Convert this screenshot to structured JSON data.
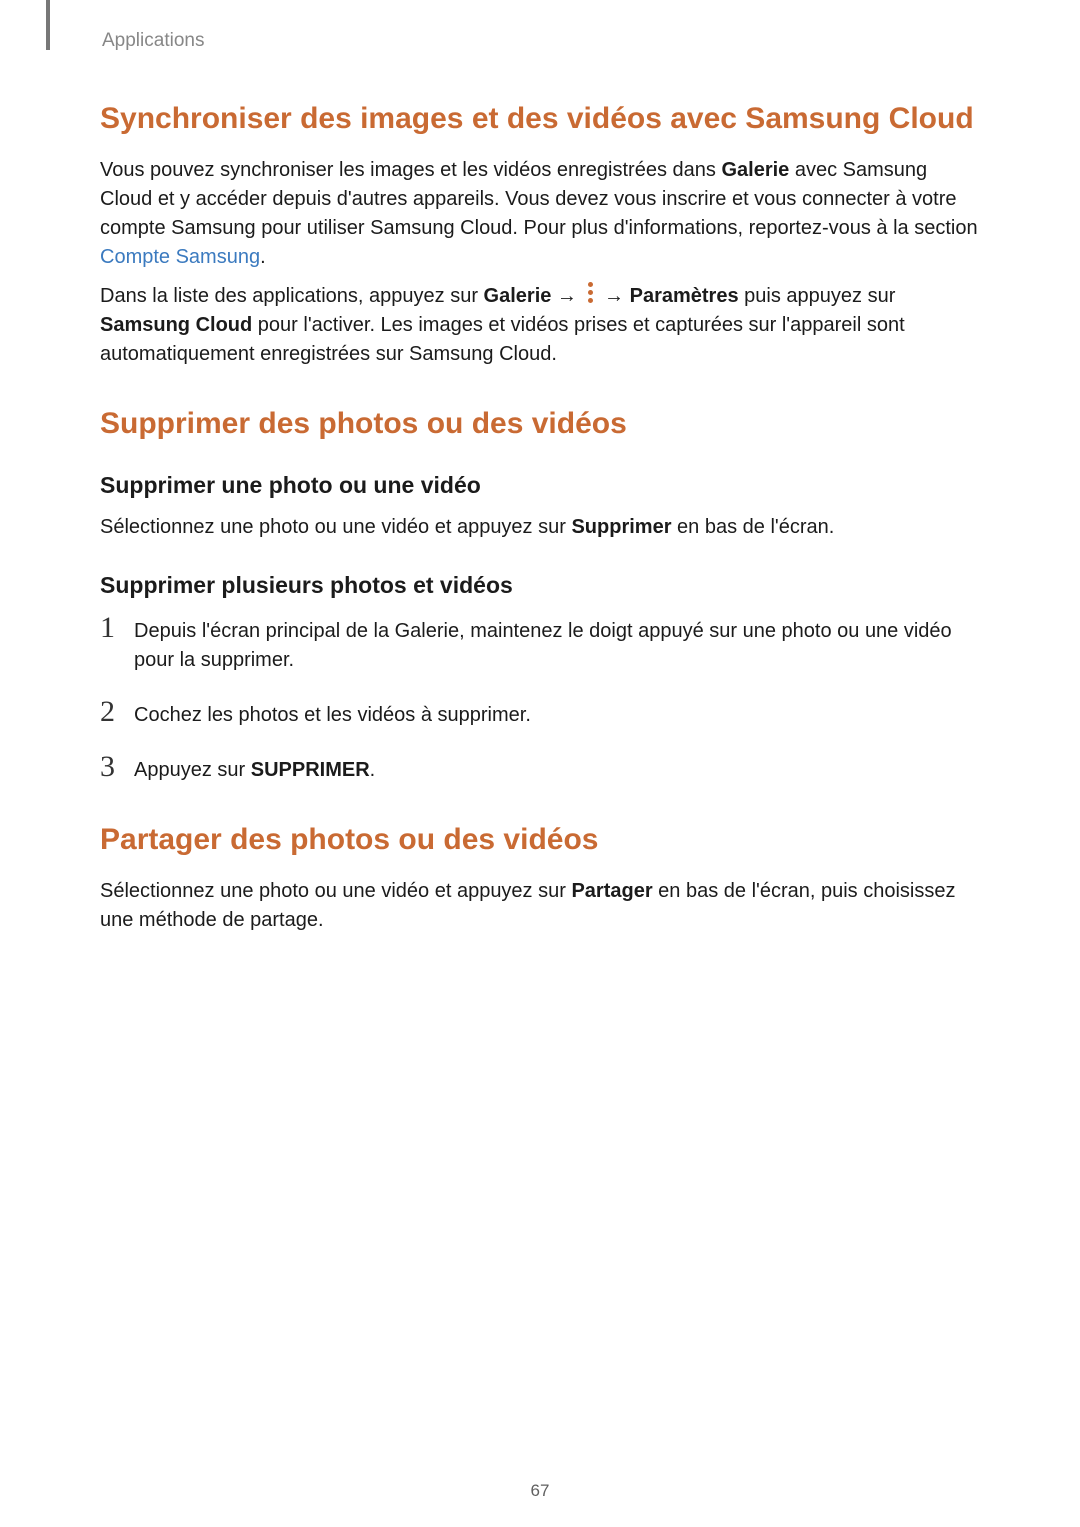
{
  "breadcrumb": "Applications",
  "page_number": "67",
  "section1": {
    "heading": "Synchroniser des images et des vidéos avec Samsung Cloud",
    "p1a": "Vous pouvez synchroniser les images et les vidéos enregistrées dans ",
    "p1b_bold": "Galerie",
    "p1c": " avec Samsung Cloud et y accéder depuis d'autres appareils. Vous devez vous inscrire et vous connecter à votre compte Samsung pour utiliser Samsung Cloud. Pour plus d'informations, reportez-vous à la section ",
    "p1_link": "Compte Samsung",
    "p1d": ".",
    "p2a": "Dans la liste des applications, appuyez sur ",
    "p2b_bold": "Galerie",
    "p2c": " → ",
    "p2d": " → ",
    "p2e_bold": "Paramètres",
    "p2f": " puis appuyez sur ",
    "p2g_bold": "Samsung Cloud",
    "p2h": " pour l'activer. Les images et vidéos prises et capturées sur l'appareil sont automatiquement enregistrées sur Samsung Cloud."
  },
  "section2": {
    "heading": "Supprimer des photos ou des vidéos",
    "sub1": {
      "heading": "Supprimer une photo ou une vidéo",
      "p1a": "Sélectionnez une photo ou une vidéo et appuyez sur ",
      "p1b_bold": "Supprimer",
      "p1c": " en bas de l'écran."
    },
    "sub2": {
      "heading": "Supprimer plusieurs photos et vidéos",
      "steps": {
        "n1": "1",
        "s1": "Depuis l'écran principal de la Galerie, maintenez le doigt appuyé sur une photo ou une vidéo pour la supprimer.",
        "n2": "2",
        "s2": "Cochez les photos et les vidéos à supprimer.",
        "n3": "3",
        "s3a": "Appuyez sur ",
        "s3b_bold": "SUPPRIMER",
        "s3c": "."
      }
    }
  },
  "section3": {
    "heading": "Partager des photos ou des vidéos",
    "p1a": "Sélectionnez une photo ou une vidéo et appuyez sur ",
    "p1b_bold": "Partager",
    "p1c": " en bas de l'écran, puis choisissez une méthode de partage."
  }
}
